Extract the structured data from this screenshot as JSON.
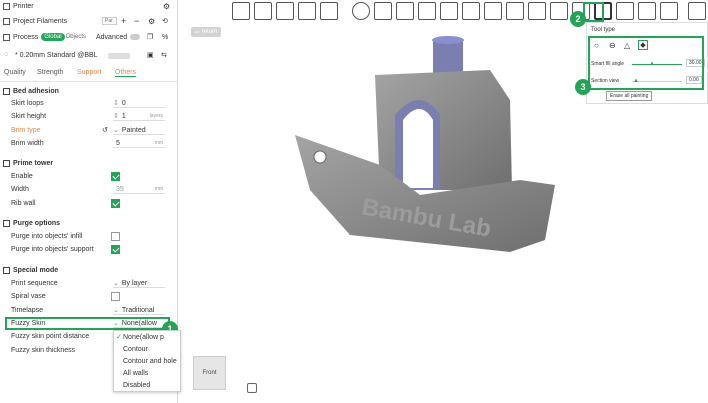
{
  "sidebar": {
    "printer_label": "Printer",
    "filaments_label": "Project Filaments",
    "filaments_badge": "Par.",
    "process_label": "Process",
    "global_tab": "Global",
    "objects_tab": "Objects",
    "advanced_label": "Advanced",
    "preset": "* 0.20mm Standard @BBL",
    "tabs": [
      "Quality",
      "Strength",
      "Support",
      "Others"
    ],
    "sections": {
      "bed_adhesion": "Bed adhesion",
      "prime_tower": "Prime tower",
      "purge_options": "Purge options",
      "special_mode": "Special mode"
    },
    "settings": {
      "skirt_loops": {
        "label": "Skirt loops",
        "value": "0"
      },
      "skirt_height": {
        "label": "Skirt height",
        "value": "1",
        "unit": "layers"
      },
      "brim_type": {
        "label": "Brim type",
        "value": "Painted"
      },
      "brim_width": {
        "label": "Brim width",
        "value": "5",
        "unit": "mm"
      },
      "enable": {
        "label": "Enable"
      },
      "width": {
        "label": "Width",
        "value": "35",
        "unit": "mm"
      },
      "rib_wall": {
        "label": "Rib wall"
      },
      "purge_infill": {
        "label": "Purge into objects' infill"
      },
      "purge_support": {
        "label": "Purge into objects' support"
      },
      "print_sequence": {
        "label": "Print sequence",
        "value": "By layer"
      },
      "spiral_vase": {
        "label": "Spiral vase"
      },
      "timelapse": {
        "label": "Timelapse",
        "value": "Traditional"
      },
      "fuzzy_skin": {
        "label": "Fuzzy Skin",
        "value": "None(allow"
      },
      "fuzzy_distance": {
        "label": "Fuzzy skin point distance"
      },
      "fuzzy_thickness": {
        "label": "Fuzzy skin thickness"
      }
    },
    "dropdown_options": [
      "None(allow p",
      "Contour",
      "Contour and hole",
      "All walls",
      "Disabled"
    ]
  },
  "viewport": {
    "return_label": "return",
    "front_label": "Front",
    "model_text": "Bambu Lab"
  },
  "tool_panel": {
    "title": "Tool type",
    "smart_fill_label": "Smart fill angle",
    "smart_fill_value": "30.00",
    "section_view_label": "Section view",
    "section_view_value": "0.00",
    "erase_label": "Erase all painting",
    "smart_fill_fraction": 0.3,
    "section_view_fraction": 0.0
  },
  "badges": [
    "1",
    "2",
    "3"
  ],
  "colors": {
    "accent": "#21a556",
    "model": "#8d8d8d",
    "highlight": "#8a8fd0"
  }
}
